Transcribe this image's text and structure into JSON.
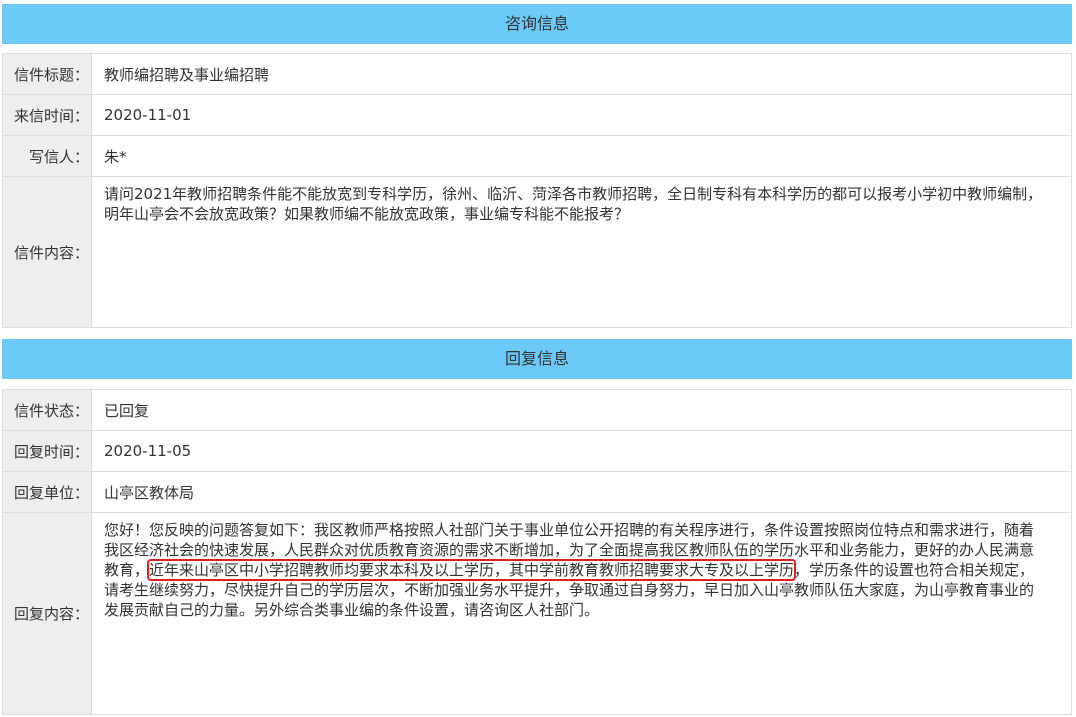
{
  "consult": {
    "header": "咨询信息",
    "rows": [
      {
        "label": "信件标题：",
        "value": "教师编招聘及事业编招聘"
      },
      {
        "label": "来信时间：",
        "value": "2020-11-01"
      },
      {
        "label": "写信人：",
        "value": "朱*"
      },
      {
        "label": "信件内容：",
        "value": "请问2021年教师招聘条件能不能放宽到专科学历，徐州、临沂、菏泽各市教师招聘，全日制专科有本科学历的都可以报考小学初中教师编制，明年山亭会不会放宽政策？如果教师编不能放宽政策，事业编专科能不能报考？"
      }
    ]
  },
  "reply": {
    "header": "回复信息",
    "rows": [
      {
        "label": "信件状态：",
        "value": "已回复"
      },
      {
        "label": "回复时间：",
        "value": "2020-11-05"
      },
      {
        "label": "回复单位：",
        "value": "山亭区教体局"
      }
    ],
    "content": {
      "label": "回复内容：",
      "part1": "您好！您反映的问题答复如下：我区教师严格按照人社部门关于事业单位公开招聘的有关程序进行，条件设置按照岗位特点和需求进行，随着我区经济社会的快速发展，人民群众对优质教育资源的需求不断增加，为了全面提高我区教师队伍的学历水平和业务能力，更好的办人民满意教育，",
      "highlight": "近年来山亭区中小学招聘教师均要求本科及以上学历，其中学前教育教师招聘要求大专及以上学历",
      "part2": "，学历条件的设置也符合相关规定，请考生继续努力，尽快提升自己的学历层次，不断加强业务水平提升，争取通过自身努力，早日加入山亭教师队伍大家庭，为山亭教育事业的发展贡献自己的力量。另外综合类事业编的条件设置，请咨询区人社部门。"
    },
    "highlight_color": "#e02020"
  },
  "colors": {
    "header_bg": "#6ccaf8",
    "label_bg": "#eeeeee",
    "border": "#dddddd"
  }
}
